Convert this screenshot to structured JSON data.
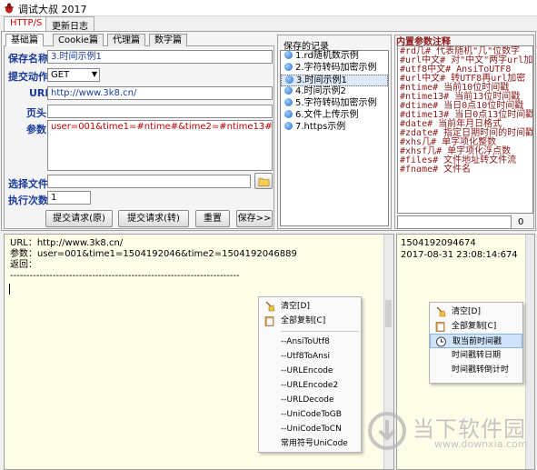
{
  "window": {
    "title": "调试大叔 2017"
  },
  "top_tabs": [
    {
      "label": "HTTP/S"
    },
    {
      "label": "更新日志"
    }
  ],
  "sub_tabs": [
    {
      "label": "基础篇"
    },
    {
      "label": "Cookie篇"
    },
    {
      "label": "代理篇"
    },
    {
      "label": "数字篇"
    }
  ],
  "form": {
    "name_label": "保存名称",
    "name_value": "3.时间示例1",
    "action_label": "提交动作",
    "action_value": "GET",
    "url_label": "URL",
    "url_value": "http://www.3k8.cn/",
    "header_label": "页头",
    "header_value": "",
    "params_label": "参数",
    "params_value": "user=001&time1=#ntime#&time2=#ntime13#",
    "file_label": "选择文件",
    "file_value": "",
    "count_label": "执行次数",
    "count_value": "1"
  },
  "buttons": {
    "submit_raw": "提交请求(原)",
    "submit_conv": "提交请求(转)",
    "reset": "重置",
    "save": "保存>>"
  },
  "saved": {
    "title": "保存的记录",
    "items": [
      "1.rd随机数示例",
      "2.字符转码加密示例",
      "3.时间示例1",
      "4.时间示例2",
      "5.字符转码加密示例",
      "6.文件上传示例",
      "7.https示例"
    ]
  },
  "ref": {
    "title": "内置参数注释",
    "lines": [
      "#rd几#    代表随机\"几\"位数字",
      "#url中文# 对\"中文\"两字url加密",
      "#utf8中文#  AnsiToUTF8",
      "#url中文# 转UTF8再url加密",
      "#ntime#      当前10位时间戳",
      "#ntime13#    当前13位时间戳",
      "#dtime#      当日0点10位时间戳",
      "#dtime13#    当日0点13位时间戳",
      "#date#     当前年月日格式",
      "#zdate#  指定日期时间的时间戳",
      "#xhs几#   单字项化整数",
      "#xhsf几#   单字项化浮点数",
      "#files#  文件地址转文件流",
      "#fname#  文件名"
    ],
    "page_value": "0"
  },
  "output": {
    "lines": [
      "URL：http://www.3k8.cn/",
      "参数：user=001&time1=1504192046&time2=1504192046889",
      "返回：",
      "----------------------------------------------------------------------"
    ]
  },
  "right_output": {
    "lines": [
      "1504192094674",
      "2017-08-31 23:08:14:674"
    ]
  },
  "menu1": {
    "items": [
      "清空[D]",
      "全部复制[C]",
      "--AnsiToUtf8",
      "--Utf8ToAnsi",
      "--URLEncode",
      "--URLEncode2",
      "--URLDecode",
      "--UniCodeToGB",
      "--UniCodeToCN",
      "常用符号UniCode"
    ]
  },
  "menu2": {
    "items": [
      "清空[D]",
      "全部复制[C]",
      "取当前时间戳",
      "时间戳转日期",
      "时间戳转倒计时"
    ]
  },
  "watermark": {
    "text": "当下软件园",
    "url": "www.downxia.com"
  },
  "colors": {
    "label_blue": "#1a3a9a",
    "ref_red": "#8b1a1a",
    "tab_red": "#d00000",
    "output_bg": "#fefee8"
  }
}
